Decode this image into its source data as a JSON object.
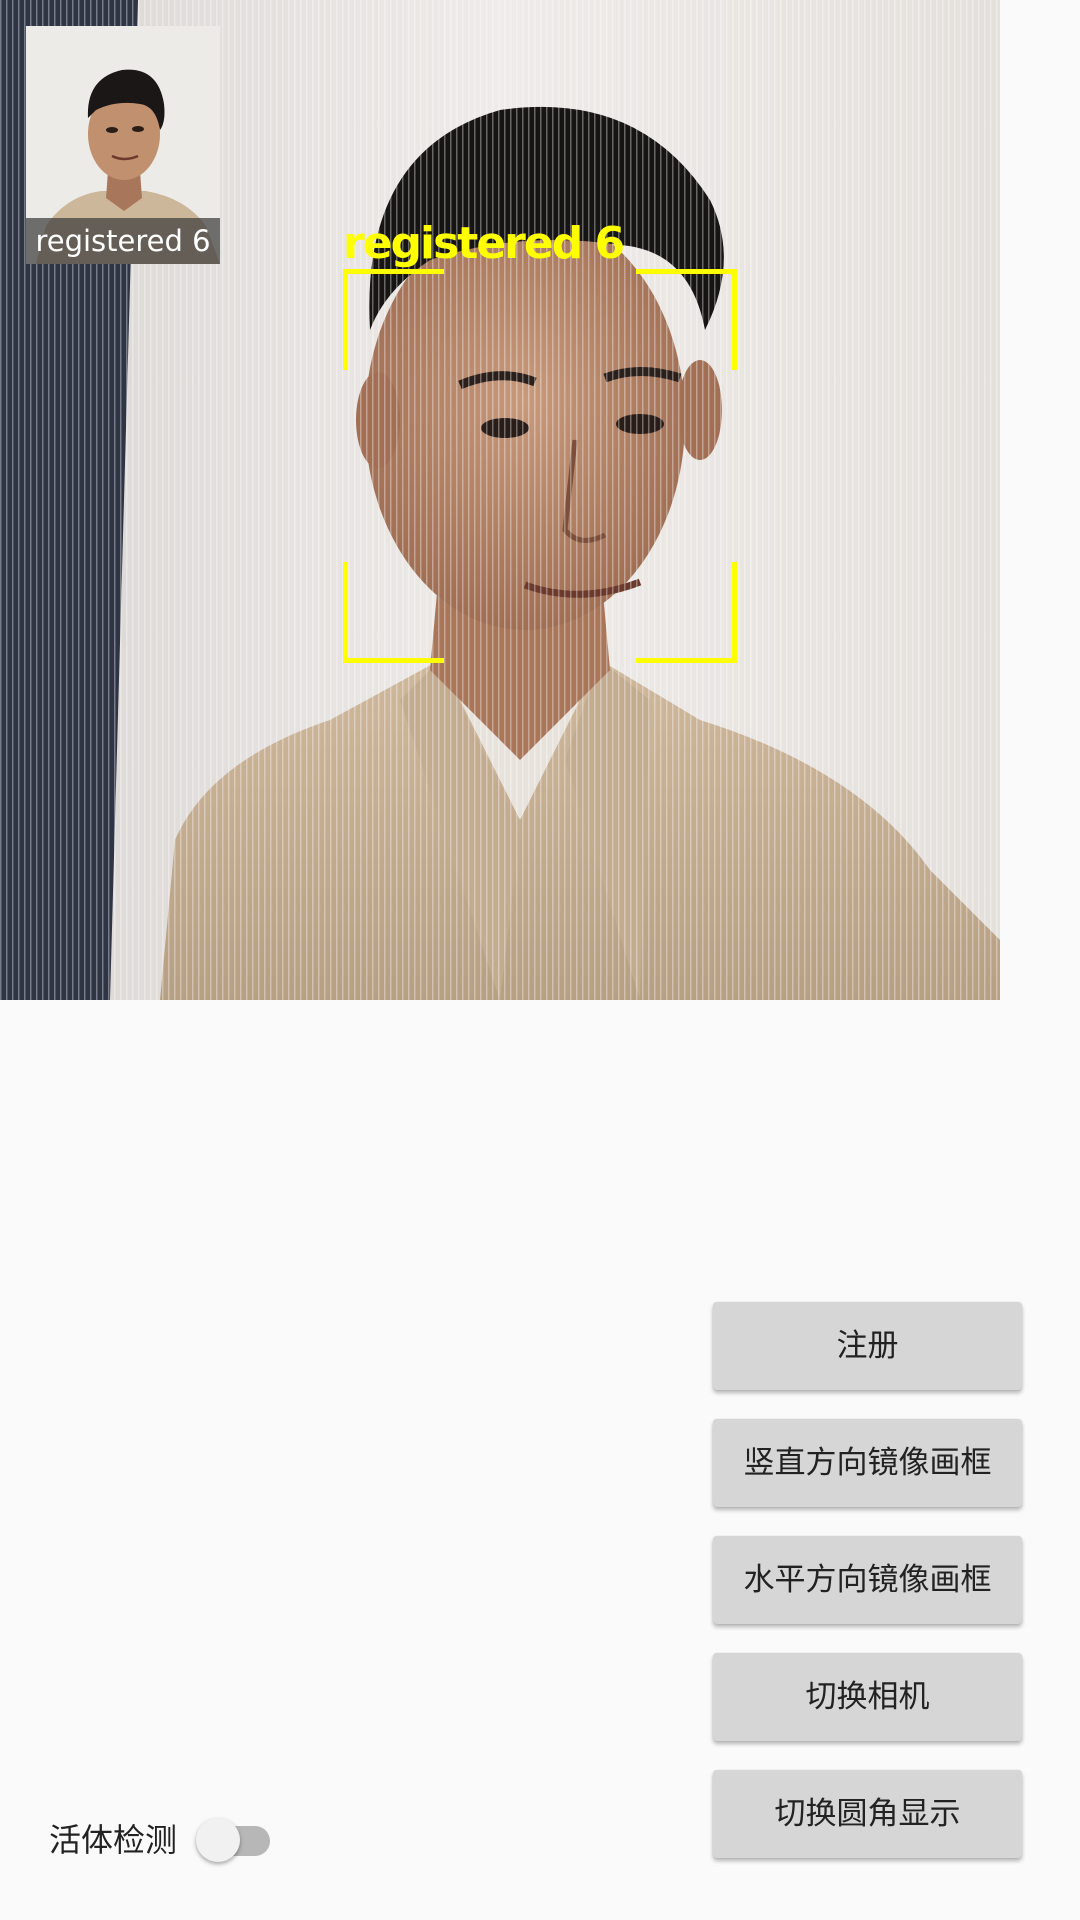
{
  "preview": {
    "registered_thumb_label": "registered 6",
    "face_label": "registered 6",
    "face_box_color": "#ffff00"
  },
  "buttons": {
    "register": "注册",
    "mirror_vertical": "竖直方向镜像画框",
    "mirror_horizontal": "水平方向镜像画框",
    "switch_camera": "切换相机",
    "toggle_round_corner": "切换圆角显示"
  },
  "liveness": {
    "label": "活体检测",
    "enabled": false
  },
  "icons": [
    "face-box-corner-icon",
    "switch-thumb-icon"
  ]
}
